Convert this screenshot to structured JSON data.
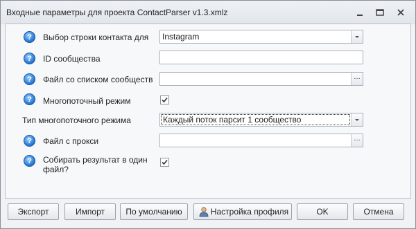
{
  "window": {
    "title": "Входные параметры для проекта ContactParser v1.3.xmlz"
  },
  "form": {
    "contact_row": {
      "label": "Выбор строки контакта для",
      "value": "Instagram"
    },
    "community_id": {
      "label": "ID сообщества",
      "value": ""
    },
    "communities_file": {
      "label": "Файл со списком сообществ",
      "value": "",
      "browse": "…"
    },
    "multithread": {
      "label": "Многопоточный режим",
      "checked": true
    },
    "multithread_type": {
      "label": "Тип многопоточного режима",
      "value": "Каждый поток парсит  1 сообщество"
    },
    "proxy_file": {
      "label": "Файл с прокси",
      "value": "",
      "browse": "…"
    },
    "single_file": {
      "label": "Собирать результат в один файл?",
      "label_line1": "Собирать результат в один",
      "label_line2": "файл?",
      "checked": true
    }
  },
  "buttons": {
    "export": "Экспорт",
    "import": "Импорт",
    "defaults": "По умолчанию",
    "profile": "Настройка профиля",
    "ok": "OK",
    "cancel": "Отмена"
  },
  "icons": {
    "help": "help-icon",
    "minimize": "minimize-icon",
    "restore": "restore-icon",
    "close": "close-icon",
    "profile": "user-icon"
  },
  "colors": {
    "help_icon": "#2f7fd8",
    "window_bg": "#f0f2f5"
  }
}
